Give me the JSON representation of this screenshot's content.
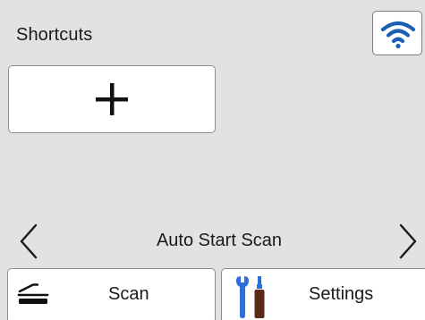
{
  "header": {
    "title": "Shortcuts",
    "wifi_icon": "wifi-icon"
  },
  "shortcuts": {
    "add_icon": "plus-icon"
  },
  "carousel": {
    "label": "Auto Start Scan",
    "prev_icon": "chevron-left-icon",
    "next_icon": "chevron-right-icon"
  },
  "bottom_bar": {
    "scan": {
      "label": "Scan",
      "icon": "scanner-icon"
    },
    "settings": {
      "label": "Settings",
      "icon": "tools-icon"
    }
  },
  "colors": {
    "background": "#e2e2e2",
    "button": "#ffffff",
    "wifi_blue": "#1a5fb4",
    "tool_blue": "#2a6fdb",
    "tool_brown": "#5a2a1a"
  }
}
